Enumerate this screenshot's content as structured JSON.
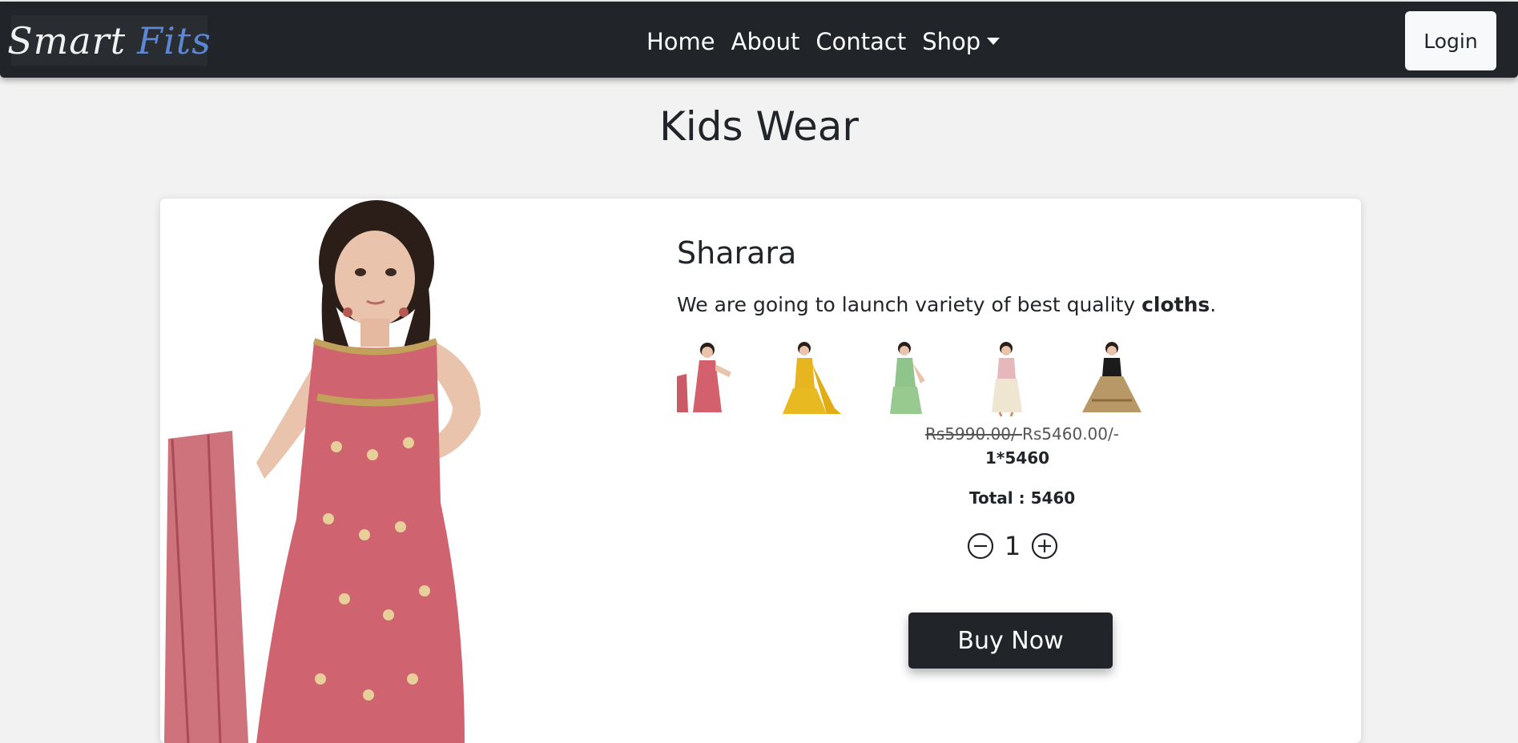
{
  "brand": {
    "word1": "Smart",
    "word2": "Fits"
  },
  "nav": {
    "home": "Home",
    "about": "About",
    "contact": "Contact",
    "shop": "Shop"
  },
  "login_label": "Login",
  "page_title": "Kids Wear",
  "product": {
    "name": "Sharara",
    "description_prefix": "We are going to launch variety of best quality ",
    "description_bold": "cloths",
    "description_suffix": ".",
    "price_old": "Rs5990.00/-",
    "price_new": "Rs5460.00/-",
    "multiplier_text": "1*5460",
    "total_text": "Total : 5460",
    "quantity": "1",
    "buy_label": "Buy Now"
  },
  "thumbnails": [
    {
      "outfit": "pink dress with dupatta",
      "color": "#d3616d"
    },
    {
      "outfit": "yellow sharara",
      "color": "#e7b51f"
    },
    {
      "outfit": "green sharara",
      "color": "#8fc58a"
    },
    {
      "outfit": "cream lehenga",
      "color": "#efe6d2"
    },
    {
      "outfit": "black and gold lehenga",
      "color": "#b99867"
    }
  ],
  "colors": {
    "navbar": "#212529",
    "brand_accent": "#5b87d4",
    "background": "#f2f2f2",
    "dress": "#cf6370"
  }
}
